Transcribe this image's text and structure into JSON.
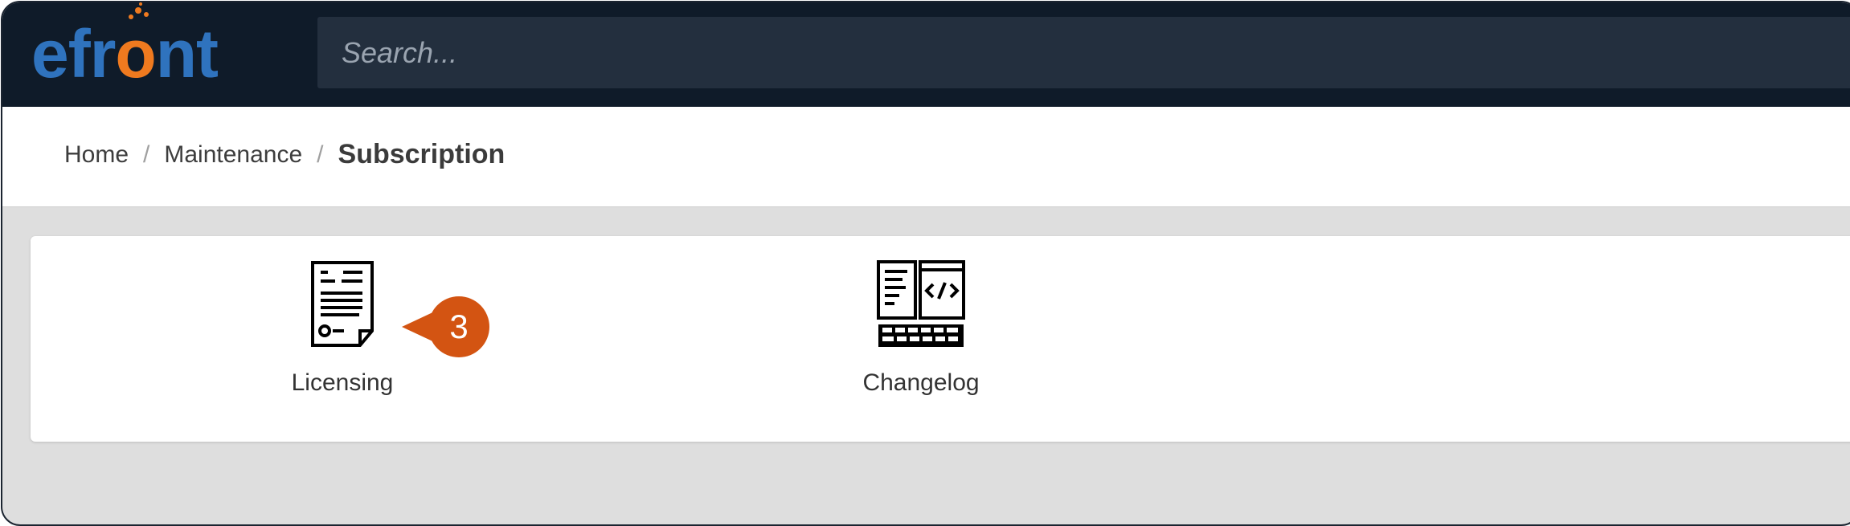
{
  "app": {
    "logo_prefix": "efr",
    "logo_o": "o",
    "logo_suffix": "nt",
    "brand_blue": "#2f73be",
    "brand_orange": "#ef7a1f"
  },
  "search": {
    "placeholder": "Search..."
  },
  "breadcrumb": {
    "items": [
      "Home",
      "Maintenance"
    ],
    "separator": "/",
    "current": "Subscription"
  },
  "tiles": [
    {
      "label": "Licensing",
      "icon": "license-document-icon"
    },
    {
      "label": "Changelog",
      "icon": "code-changelog-icon"
    }
  ],
  "callout": {
    "number": "3",
    "color": "#d35412"
  }
}
